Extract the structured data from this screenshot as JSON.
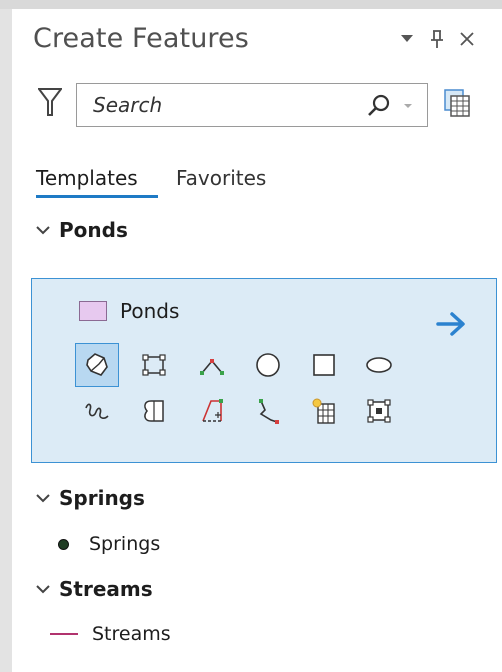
{
  "pane": {
    "title": "Create Features",
    "controls": {
      "dropdown_icon": "triangle-down-icon",
      "pin_icon": "pin-icon",
      "close_icon": "close-icon"
    }
  },
  "search": {
    "placeholder": "Search",
    "value": ""
  },
  "tabs": [
    {
      "label": "Templates",
      "active": true
    },
    {
      "label": "Favorites",
      "active": false
    }
  ],
  "groups": {
    "ponds": {
      "header": "Ponds",
      "template": {
        "label": "Ponds",
        "swatch_color": "#e7c9ef"
      },
      "tools": [
        "autocomplete-polygon-icon",
        "polygon-icon",
        "line-vertex-icon",
        "circle-icon",
        "rectangle-icon",
        "ellipse-icon",
        "freehand-icon",
        "autocomplete-freehand-icon",
        "right-angle-polygon-icon",
        "trace-icon",
        "split-polygon-icon",
        "reshape-icon"
      ]
    },
    "springs": {
      "header": "Springs",
      "item": {
        "label": "Springs",
        "symbol_color": "#1f3c23"
      }
    },
    "streams": {
      "header": "Streams",
      "item": {
        "label": "Streams",
        "symbol_color": "#b1336e"
      }
    }
  },
  "colors": {
    "accent": "#1e7ac5",
    "selection_fill": "#dcebf6",
    "selection_border": "#3c92d4"
  }
}
